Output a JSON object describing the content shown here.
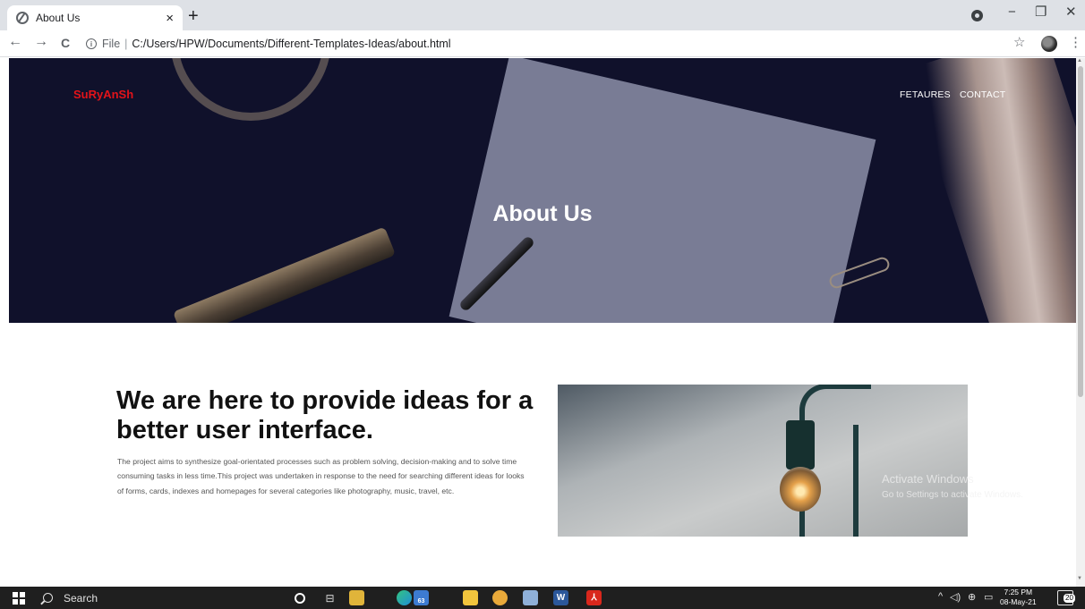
{
  "browser": {
    "tab_title": "About Us",
    "tab_close": "×",
    "new_tab": "+",
    "nav": {
      "back": "←",
      "forward": "→",
      "reload": "C"
    },
    "address": {
      "prefix": "File",
      "separator": "|",
      "url": "C:/Users/HPW/Documents/Different-Templates-Ideas/about.html"
    },
    "window_controls": {
      "minimize": "−",
      "maximize": "❐",
      "close": "✕"
    },
    "star": "☆",
    "menu": "⋮"
  },
  "page": {
    "brand": "SuRyAnSh",
    "nav_links": [
      "FETAURES",
      "CONTACT"
    ],
    "hero_title": "About Us",
    "headline": "We are here to provide ideas for a better user interface.",
    "body": "The project aims to synthesize goal-orientated processes such as problem solving, decision-making and to solve time consuming tasks in less time.This project was undertaken in response to the need for searching different ideas for looks of forms, cards, indexes and homepages for several categories like photography, music, travel, etc."
  },
  "watermark": {
    "line1": "Activate Windows",
    "line2": "Go to Settings to activate Windows."
  },
  "taskbar": {
    "search": "Search",
    "mail_badge": "63",
    "tray_chevron": "^",
    "time": "7:25 PM",
    "date": "08-May-21",
    "notification_count": "20"
  },
  "colors": {
    "brand": "#e3131a",
    "hero_bg": "#10112b",
    "taskbar": "#1f1f1f"
  }
}
